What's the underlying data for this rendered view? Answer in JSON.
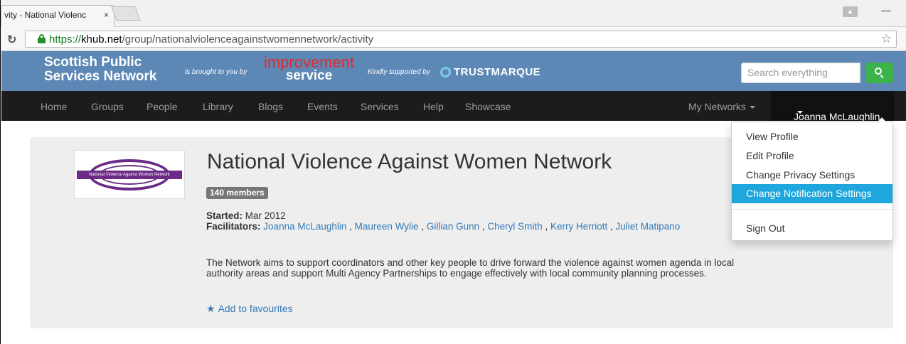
{
  "browser": {
    "tab_title": "vity - National Violenc",
    "tab_close": "×",
    "url_scheme": "https://",
    "url_host": "khub.net",
    "url_path": "/group/nationalviolenceagainstwomennetwork/activity",
    "reload_icon": "↻",
    "star_icon": "☆",
    "minimize": "—"
  },
  "header": {
    "brand_line1": "Scottish Public",
    "brand_line2": "Services Network",
    "brought_by": "is brought to you by",
    "improvement_line1": "improvement",
    "improvement_line2": "service",
    "kindly": "Kindly supported by",
    "trustmarque": "TRUSTMARQUE",
    "search_placeholder": "Search everything"
  },
  "nav": {
    "items": [
      "Home",
      "Groups",
      "People",
      "Library",
      "Blogs",
      "Events",
      "Services",
      "Help",
      "Showcase"
    ],
    "my_networks": "My Networks",
    "user_name": "Joanna McLaughlin"
  },
  "dropdown": {
    "items": [
      "View Profile",
      "Edit Profile",
      "Change Privacy Settings",
      "Change Notification Settings",
      "Sign Out"
    ],
    "active_index": 3
  },
  "group": {
    "logo_text": "National Violence Against Women Network",
    "title": "National Violence Against Women Network",
    "members": "140 members",
    "started_label": "Started:",
    "started_value": "Mar 2012",
    "facilitators_label": "Facilitators:",
    "facilitators": [
      "Joanna McLaughlin",
      "Maureen Wylie",
      "Gillian Gunn",
      "Cheryl Smith",
      "Kerry Herriott",
      "Juliet Matipano"
    ],
    "description": "The Network aims to support coordinators and other key people to drive forward the violence against women agenda in local authority areas and support Multi Agency Partnerships to engage effectively with local community planning processes.",
    "add_favourites": "Add to favourites"
  },
  "colors": {
    "header_blue": "#5d88b5",
    "nav_black": "#1c1c1c",
    "link_blue": "#337ab7",
    "active_item": "#1fa6dc",
    "search_green": "#3cb34a"
  }
}
